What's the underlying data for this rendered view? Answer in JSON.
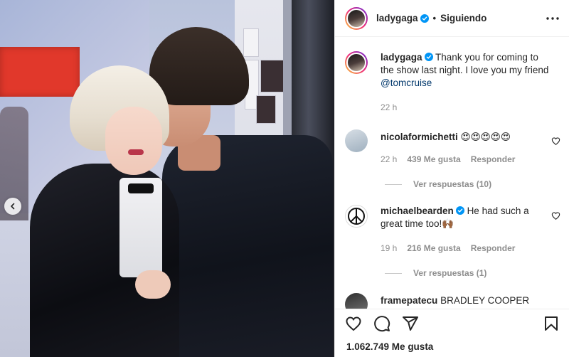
{
  "post": {
    "username": "ladygaga",
    "follow_status": "Siguiendo",
    "caption_user": "ladygaga",
    "caption_text": "Thank you for coming to the show last night. I love you my friend ",
    "caption_mention": "@tomcruise",
    "caption_time": "22 h",
    "likes": "1.062.749 Me gusta"
  },
  "comments": [
    {
      "username": "nicolaformichetti",
      "text": "😍😍😍😍😍",
      "time": "22 h",
      "likes": "439 Me gusta",
      "reply": "Responder",
      "view_replies": "Ver respuestas (10)"
    },
    {
      "username": "michaelbearden",
      "text": "He had such a great time too!🙌🏾",
      "time": "19 h",
      "likes": "216 Me gusta",
      "reply": "Responder",
      "view_replies": "Ver respuestas (1)"
    },
    {
      "username": "framepatecu",
      "text": "BRADLEY COOPER"
    }
  ],
  "icons": {
    "more": "more-horizontal-icon",
    "like": "heart-icon",
    "comment": "comment-icon",
    "share": "share-icon",
    "save": "bookmark-icon",
    "carousel": "chevron-left-icon",
    "verified": "verified-badge-icon"
  },
  "colors": {
    "text": "#262626",
    "muted": "#8e8e8e",
    "mention": "#00376b",
    "verified": "#0095f6"
  }
}
